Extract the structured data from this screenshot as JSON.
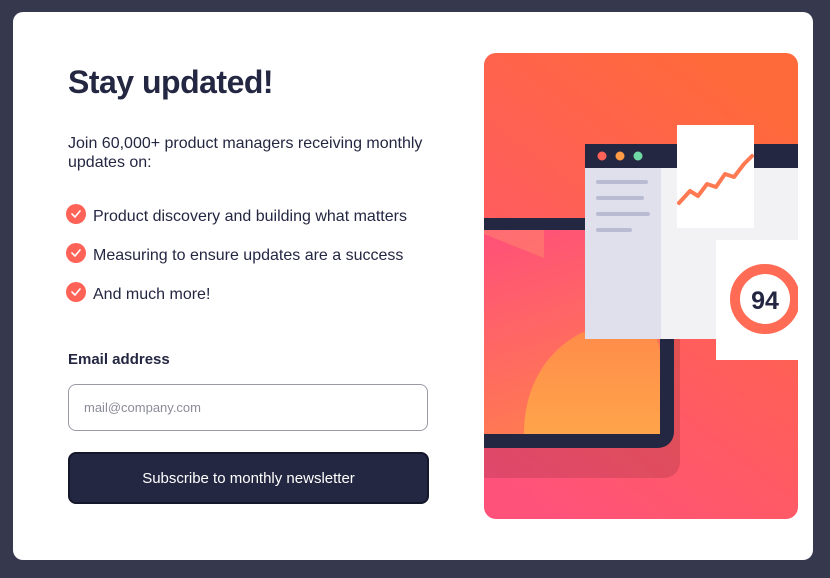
{
  "card": {
    "title": "Stay updated!",
    "intro": "Join 60,000+ product managers receiving monthly updates on:",
    "features": [
      "Product discovery and building what matters",
      "Measuring to ensure updates are a success",
      "And much more!"
    ]
  },
  "form": {
    "email_label": "Email address",
    "email_placeholder": "mail@company.com",
    "email_value": "",
    "submit_label": "Subscribe to monthly newsletter"
  },
  "illustration": {
    "score": "94"
  },
  "colors": {
    "accent": "#ff6257",
    "dark_navy": "#242742",
    "charcoal": "#36384e",
    "gradient_top": "#ff6a3a",
    "gradient_bottom": "#ff527b"
  },
  "icons": {
    "feature_bullet": "check-icon"
  }
}
